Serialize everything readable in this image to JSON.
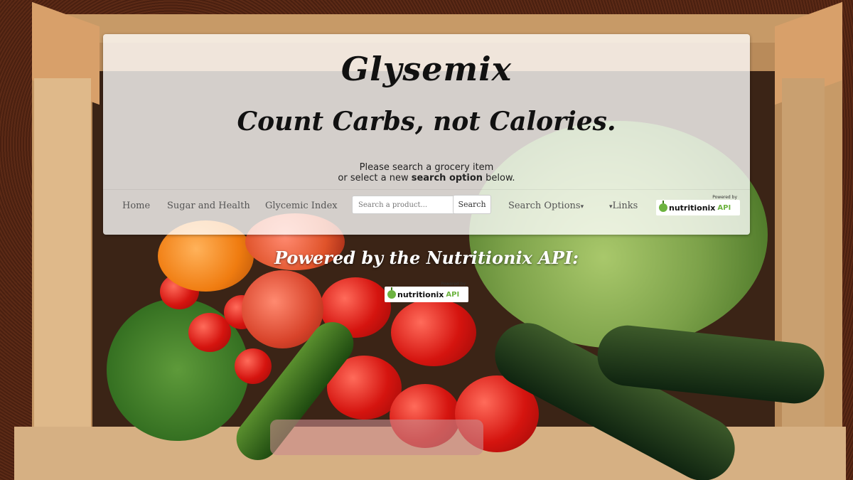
{
  "brand": "Glysemix",
  "tagline": "Count Carbs, not Calories.",
  "hint": {
    "line1": "Please search a grocery item",
    "line2_prefix": "or select a new ",
    "line2_bold": "search option",
    "line2_suffix": " below."
  },
  "navbar": {
    "home": "Home",
    "sugar_health": "Sugar and Health",
    "glycemic_index": "Glycemic Index",
    "search_placeholder": "Search a product...",
    "search_button": "Search",
    "search_options": "Search Options",
    "links": "Links",
    "caret": "▾"
  },
  "nutritionix_logo": {
    "powered_by": "Powered by",
    "word": "nutritionix",
    "api": "API"
  },
  "powered_heading": "Powered by the Nutritionix API:"
}
